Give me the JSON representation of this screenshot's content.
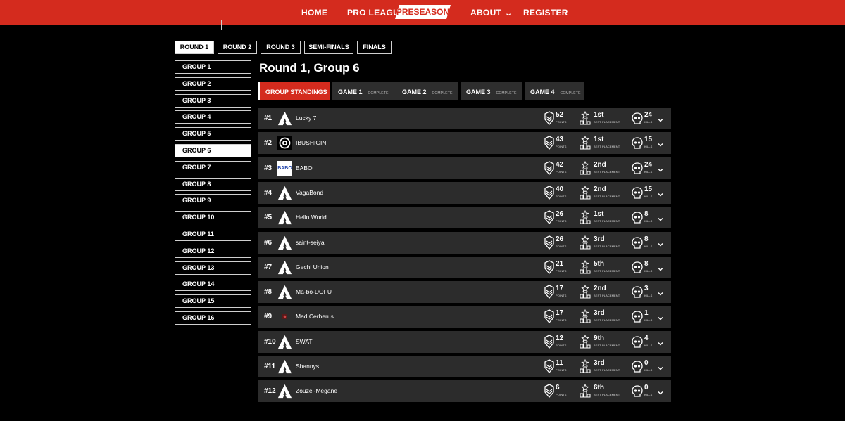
{
  "nav": {
    "items": [
      {
        "label": "HOME",
        "chevron": false
      },
      {
        "label": "PRO LEAGUE",
        "chevron": true
      },
      {
        "label": "PRESEASON",
        "active": true
      },
      {
        "label": "ABOUT",
        "chevron": true
      },
      {
        "label": "REGISTER",
        "chevron": false
      }
    ]
  },
  "rounds": [
    "ROUND 1",
    "ROUND 2",
    "ROUND 3",
    "SEMI-FINALS",
    "FINALS"
  ],
  "groups": [
    "GROUP 1",
    "GROUP 2",
    "GROUP 3",
    "GROUP 4",
    "GROUP 5",
    "GROUP 6",
    "GROUP 7",
    "GROUP 8",
    "GROUP 9",
    "GROUP 10",
    "GROUP 11",
    "GROUP 12",
    "GROUP 13",
    "GROUP 14",
    "GROUP 15",
    "GROUP 16"
  ],
  "active_group": "GROUP 6",
  "title": "Round 1, Group 6",
  "game_tabs": [
    {
      "label": "GROUP STANDINGS",
      "status": "",
      "active": true
    },
    {
      "label": "GAME 1",
      "status": "COMPLETE"
    },
    {
      "label": "GAME 2",
      "status": "COMPLETE"
    },
    {
      "label": "GAME 3",
      "status": "COMPLETE"
    },
    {
      "label": "GAME 4",
      "status": "COMPLETE"
    }
  ],
  "stat_labels": {
    "points": "POINTS",
    "placement": "BEST PLACEMENT",
    "kills": "KILLS"
  },
  "colors": {
    "accent": "#d42b1e",
    "row_bg": "#2c2c2c",
    "tab_bg": "#2e2e2e"
  },
  "standings": [
    {
      "rank": "#1",
      "team": "Lucky 7",
      "logo": "apex-logo",
      "points": "52",
      "placement": "1st",
      "kills": "24"
    },
    {
      "rank": "#2",
      "team": "IBUSHIGIN",
      "logo": "ibushigin-logo",
      "points": "43",
      "placement": "1st",
      "kills": "15"
    },
    {
      "rank": "#3",
      "team": "BABO",
      "logo": "babo-logo",
      "logo_text": "BABO",
      "points": "42",
      "placement": "2nd",
      "kills": "24"
    },
    {
      "rank": "#4",
      "team": "VagaBond",
      "logo": "apex-logo",
      "points": "40",
      "placement": "2nd",
      "kills": "15"
    },
    {
      "rank": "#5",
      "team": "Hello World",
      "logo": "apex-logo",
      "points": "26",
      "placement": "1st",
      "kills": "8"
    },
    {
      "rank": "#6",
      "team": "saint-seiya",
      "logo": "apex-logo",
      "points": "26",
      "placement": "3rd",
      "kills": "8"
    },
    {
      "rank": "#7",
      "team": "Gechi Union",
      "logo": "apex-logo",
      "points": "21",
      "placement": "5th",
      "kills": "8"
    },
    {
      "rank": "#8",
      "team": "Ma-bo-DOFU",
      "logo": "apex-logo",
      "points": "17",
      "placement": "2nd",
      "kills": "3"
    },
    {
      "rank": "#9",
      "team": "Mad Cerberus",
      "logo": "cerberus-logo",
      "points": "17",
      "placement": "3rd",
      "kills": "1"
    },
    {
      "rank": "#10",
      "team": "SWAT",
      "logo": "apex-logo",
      "points": "12",
      "placement": "9th",
      "kills": "4"
    },
    {
      "rank": "#11",
      "team": "Shannys",
      "logo": "apex-logo",
      "points": "11",
      "placement": "3rd",
      "kills": "0"
    },
    {
      "rank": "#12",
      "team": "Zouzei-Megane",
      "logo": "apex-logo",
      "points": "6",
      "placement": "6th",
      "kills": "0"
    }
  ]
}
